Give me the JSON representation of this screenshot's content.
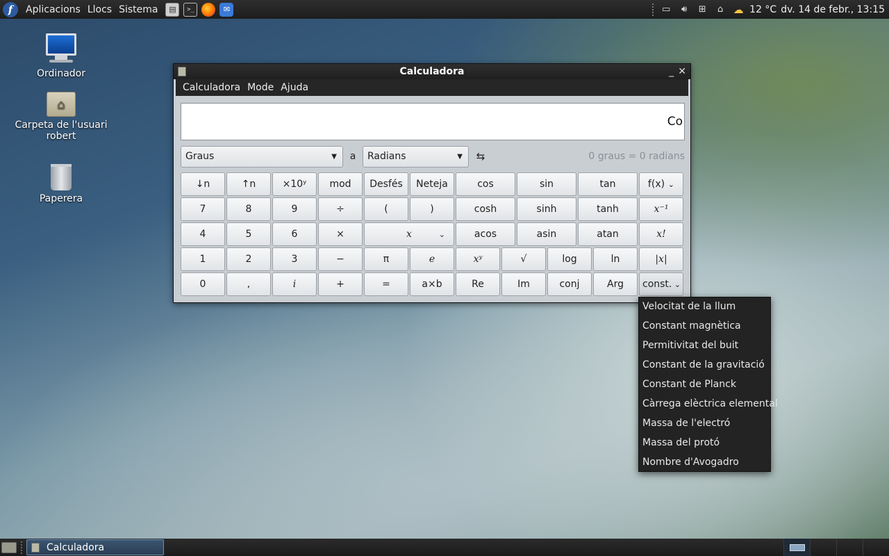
{
  "top_panel": {
    "menus": [
      "Aplicacions",
      "Llocs",
      "Sistema"
    ],
    "temperature": "12 °C",
    "clock": "dv. 14 de febr., 13:15"
  },
  "desktop": {
    "icons": [
      {
        "label": "Ordinador",
        "icon": "computer-icon"
      },
      {
        "label": "Carpeta de l'usuari robert",
        "icon": "home-folder-icon"
      },
      {
        "label": "Paperera",
        "icon": "trash-icon"
      }
    ]
  },
  "window": {
    "title": "Calculadora",
    "menus": [
      "Calculadora",
      "Mode",
      "Ajuda"
    ],
    "display_text": "Co",
    "converter": {
      "from_unit": "Graus",
      "to_label": "a",
      "to_unit": "Radians",
      "swap_symbol": "⇆",
      "result": "0 graus = 0 radians"
    }
  },
  "keypad": {
    "row1": [
      "↓n",
      "↑n",
      "×10ʸ",
      "mod",
      "Desfés",
      "Neteja",
      "cos",
      "sin",
      "tan",
      "f(x)"
    ],
    "row2": [
      "7",
      "8",
      "9",
      "÷",
      "(",
      ")",
      "cosh",
      "sinh",
      "tanh",
      "x⁻¹"
    ],
    "row3": [
      "4",
      "5",
      "6",
      "×",
      "x",
      "acos",
      "asin",
      "atan",
      "x!"
    ],
    "row4": [
      "1",
      "2",
      "3",
      "−",
      "π",
      "e",
      "xʸ",
      "√",
      "log",
      "ln",
      "|x|"
    ],
    "row5": [
      "0",
      ",",
      "i",
      "+",
      "=",
      "a×b",
      "Re",
      "Im",
      "conj",
      "Arg",
      "const."
    ]
  },
  "const_menu": {
    "items": [
      "Velocitat de la llum",
      "Constant magnètica",
      "Permitivitat del buit",
      "Constant de la gravitació",
      "Constant de Planck",
      "Càrrega elèctrica elemental",
      "Massa de l'electró",
      "Massa del protó",
      "Nombre d'Avogadro"
    ]
  },
  "taskbar": {
    "task": "Calculadora"
  }
}
